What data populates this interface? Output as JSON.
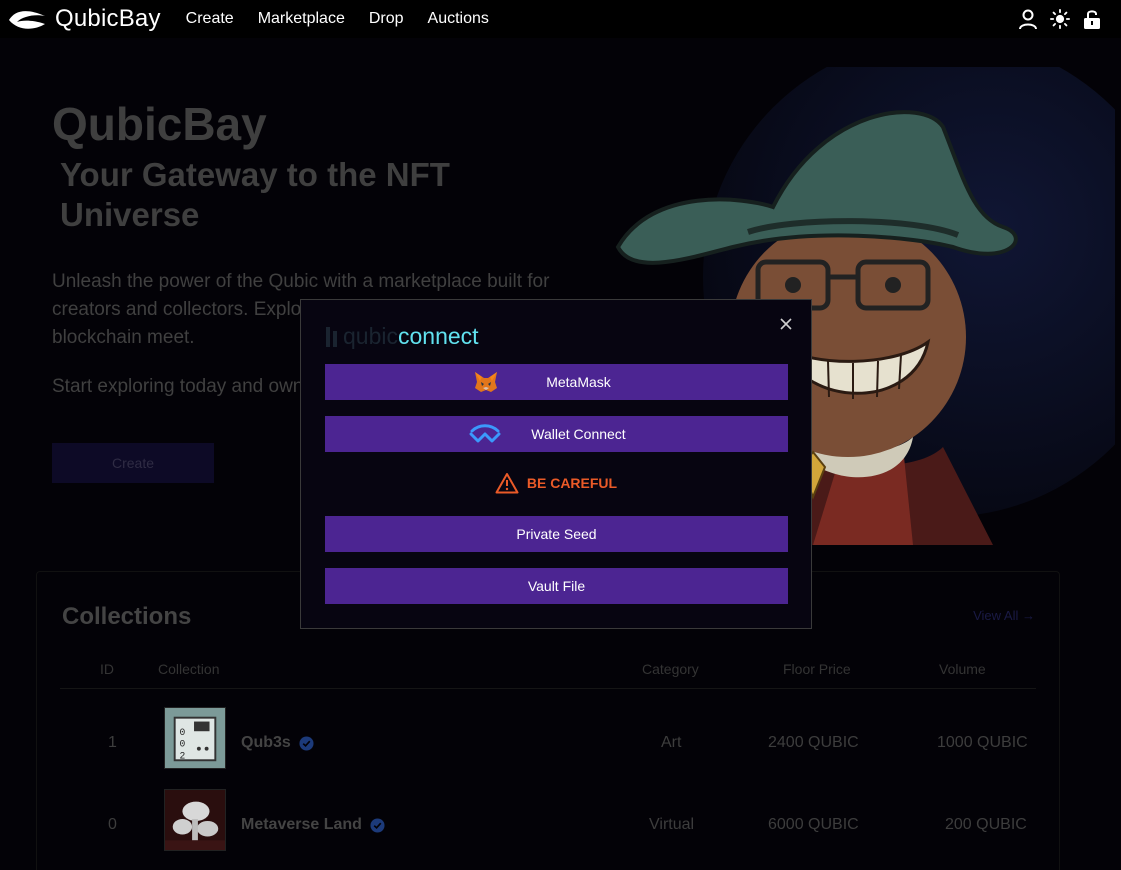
{
  "nav": {
    "brand": "QubicBay",
    "links": [
      "Create",
      "Marketplace",
      "Drop",
      "Auctions"
    ],
    "icons": [
      "user-icon",
      "sun-icon",
      "unlock-icon"
    ]
  },
  "hero": {
    "title": "QubicBay",
    "subtitle": "Your Gateway to the NFT Universe",
    "description": "Unleash the power of the Qubic with a marketplace built for creators and collectors. Explore a world where art, innovation, and blockchain meet.",
    "cta_text": "Start exploring today and own the future.",
    "create_button": "Create"
  },
  "collections": {
    "title": "Collections",
    "view_all": "View All →",
    "columns": [
      "ID",
      "Collection",
      "Category",
      "Floor Price",
      "Volume"
    ],
    "rows": [
      {
        "id": "1",
        "name": "Qub3s",
        "category": "Art",
        "floor_price": "2400 QUBIC",
        "volume": "1000 QUBIC"
      },
      {
        "id": "0",
        "name": "Metaverse Land",
        "category": "Virtual",
        "floor_price": "6000 QUBIC",
        "volume": "200 QUBIC"
      }
    ]
  },
  "modal": {
    "logo_qubic": "qubic",
    "logo_connect": "connect",
    "buttons": {
      "metamask": "MetaMask",
      "walletconnect": "Wallet Connect",
      "private_seed": "Private Seed",
      "vault_file": "Vault File"
    },
    "warning": "BE CAREFUL"
  },
  "colors": {
    "accent": "#4c2592",
    "connect_cyan": "#61e2ef",
    "warning": "#ea5a28"
  }
}
